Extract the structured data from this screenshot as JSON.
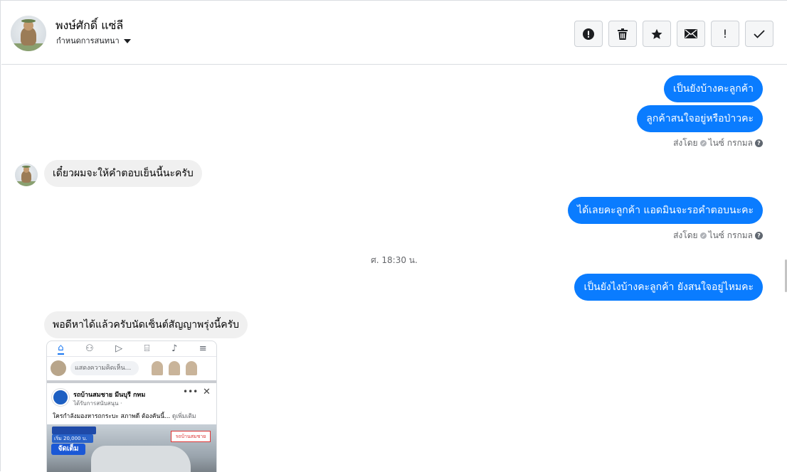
{
  "header": {
    "contact_name": "พงษ์ศักดิ์ แซ่ลี",
    "conversation_setting": "กำหนดการสนทนา",
    "toolbar": [
      {
        "name": "spam-button",
        "icon": "alert-circle-icon"
      },
      {
        "name": "delete-button",
        "icon": "trash-icon"
      },
      {
        "name": "star-button",
        "icon": "star-icon"
      },
      {
        "name": "mark-unread-button",
        "icon": "envelope-icon"
      },
      {
        "name": "mark-important-button",
        "icon": "exclamation-icon",
        "glyph": "!"
      },
      {
        "name": "mark-done-button",
        "icon": "check-icon"
      }
    ]
  },
  "messages": {
    "out_1": "เป็นยังบ้างคะลูกค้า",
    "out_2": "ลูกค้าสนใจอยู่หรือป่าวคะ",
    "sent_by_1": "ส่งโดย",
    "sender_1": "ไนซ์ กรกมล",
    "in_1": "เดี๋ยวผมจะให้คำตอบเย็นนี้นะครับ",
    "out_3": "ได้เลยคะลูกค้า แอดมินจะรอคำตอบนะคะ",
    "sent_by_2": "ส่งโดย",
    "sender_2": "ไนซ์ กรกมล",
    "time_divider": "ศ. 18:30 น.",
    "out_4": "เป็นยังไงบ้างคะลูกค้า ยังสนใจอยู่ไหมคะ",
    "in_2": "พอดีหาได้แล้วครับนัดเซ็นต์สัญญาพรุ่งนี้ครับ"
  },
  "shared_image": {
    "compose_placeholder": "แสดงความคิดเห็น...",
    "page_name": "รถบ้านสมชาย มีนบุรี กทม",
    "page_sub": "ได้รับการสนับสนุน · ",
    "caption": "ใครกำลังมองหารถกระบะ สภาพดี ต้องคันนี้...",
    "caption_more": " ดูเพิ่มเติม",
    "photo_price": "เริ่ม 20,000 บ.",
    "photo_badge": "จัดเต็ม",
    "photo_logo": "รถบ้านสมชาย"
  },
  "colors": {
    "outgoing_bubble": "#0a7cff",
    "incoming_bubble": "#f0f0f0",
    "meta_text": "#65676b"
  }
}
